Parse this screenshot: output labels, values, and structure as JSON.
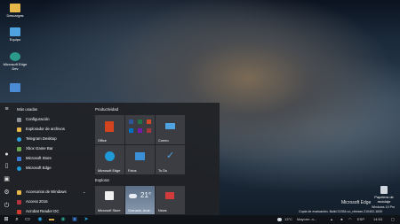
{
  "desktop": {
    "icons": [
      {
        "label": "Descargas"
      },
      {
        "label": "Equipo"
      },
      {
        "label": "Microsoft Edge Dev"
      },
      {
        "label": ""
      }
    ],
    "recycle_bin": {
      "label": "Papelera de reciclaje"
    },
    "watermark": {
      "brand": "Microsoft Edge",
      "line2": "Windows 10 Pro",
      "build": "Copia de evaluación. Build 21354.co_release.210402-1630"
    }
  },
  "start_menu": {
    "recent_header": "Más usadas",
    "apps": [
      {
        "label": "Configuración",
        "color": "#8b8f96"
      },
      {
        "label": "Explorador de archivos",
        "color": "#e6b84a"
      },
      {
        "label": "Telegram Desktop",
        "color": "#2aa3e0"
      },
      {
        "label": "Xbox Game Bar",
        "color": "#6aa84f"
      },
      {
        "label": "Microsoft Store",
        "color": "#3b7bd4"
      },
      {
        "label": "Microsoft Edge",
        "color": "#1f9ad6"
      },
      {
        "label": "Accesorios de Windows",
        "color": "#e6b84a"
      },
      {
        "label": "Access 2016",
        "color": "#b7333d"
      },
      {
        "label": "Acrobat Reader DC",
        "color": "#d23b2f"
      }
    ],
    "group_productividad": "Productividad",
    "group_explorar": "Explorar",
    "tiles": {
      "office": "Office",
      "correo": "Correo",
      "edge": "Microsoft Edge",
      "fotos": "Fotos",
      "todo": "To Do",
      "store": "Microsoft Store",
      "weather_city": "Granada, Andr...",
      "weather_temp": "21°",
      "news": "News"
    }
  },
  "taskbar": {
    "tray_temp": "13°C",
    "tray_weather": "Mayorm. n...",
    "tray_lang": "ESP",
    "tray_time": "14:53"
  }
}
